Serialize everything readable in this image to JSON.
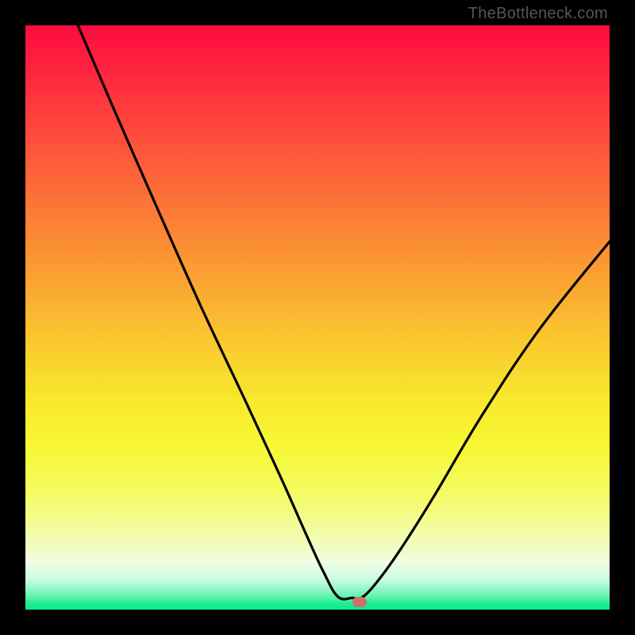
{
  "watermark": "TheBottleneck.com",
  "chart_data": {
    "type": "line",
    "title": "",
    "xlabel": "",
    "ylabel": "",
    "xlim": [
      0,
      100
    ],
    "ylim": [
      0,
      100
    ],
    "grid": false,
    "series": [
      {
        "name": "bottleneck-curve",
        "x": [
          9,
          15,
          22,
          30,
          38,
          44,
          48,
          51,
          53.5,
          56,
          57.5,
          60,
          64,
          70,
          78,
          88,
          100
        ],
        "values": [
          100,
          86,
          70,
          52,
          35,
          22,
          13,
          6.5,
          2.2,
          2,
          2,
          4.5,
          10,
          19.5,
          33,
          48,
          63
        ]
      }
    ],
    "marker": {
      "x": 57.2,
      "y": 1.3
    },
    "colors": {
      "curve": "#000000",
      "marker": "#cd716a"
    }
  }
}
